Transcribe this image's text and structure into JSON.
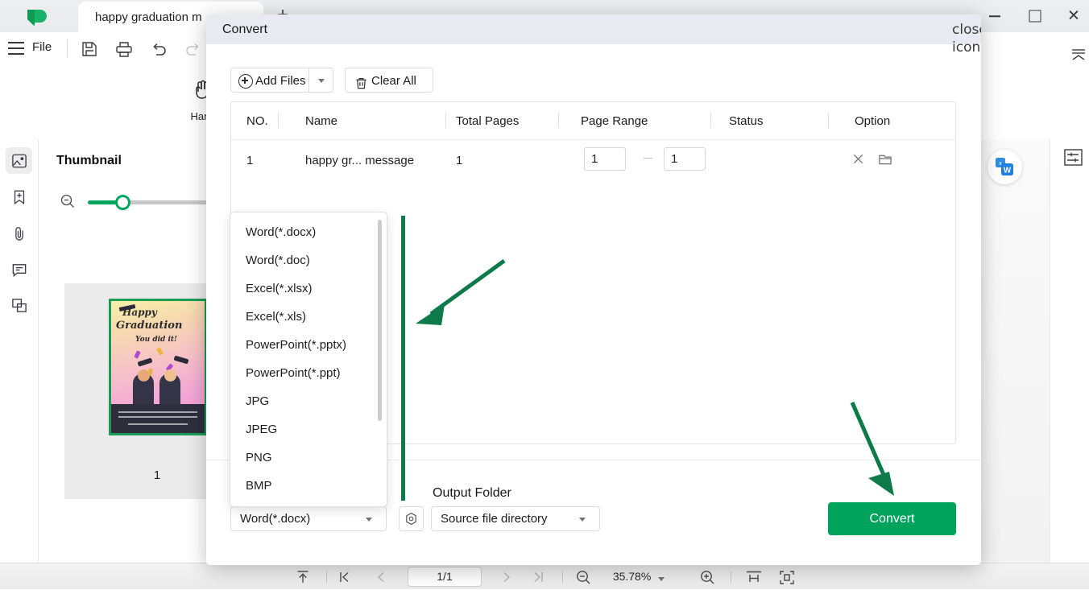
{
  "window": {
    "app_logo": "app-logo-icon",
    "tab_title": "happy graduation m",
    "new_tab": "+",
    "minimize": "minimize-icon",
    "maximize": "maximize-icon",
    "close": "close-icon"
  },
  "menubar": {
    "hamburger": "hamburger-icon",
    "file": "File",
    "icons": [
      "save-icon",
      "print-icon",
      "undo-icon",
      "redo-icon"
    ],
    "collapse_ribbon": "collapse-ribbon-icon"
  },
  "toolbar": {
    "hand_tool_label": "Hand",
    "hand_tool_icon": "hand-icon"
  },
  "left_rail": {
    "items": [
      {
        "name": "thumbnail-panel-icon",
        "active": true
      },
      {
        "name": "bookmark-add-icon",
        "active": false
      },
      {
        "name": "attachment-icon",
        "active": false
      },
      {
        "name": "comment-icon",
        "active": false
      },
      {
        "name": "layers-icon",
        "active": false
      }
    ]
  },
  "thumbnail_panel": {
    "title": "Thumbnail",
    "zoom_out_icon": "zoom-out-icon",
    "zoom_slider_value": 18,
    "page_number": "1",
    "poster": {
      "line1": "Happy",
      "line2": "Graduation",
      "line3": "You did it!"
    }
  },
  "right_rail": {
    "properties_icon": "properties-icon",
    "word_badge_icon": "word-convert-badge-icon"
  },
  "statusbar": {
    "fit_top_icon": "scroll-to-top-icon",
    "first_page_icon": "first-page-icon",
    "prev_page_icon": "previous-page-icon",
    "page_indicator": "1/1",
    "next_page_icon": "next-page-icon",
    "last_page_icon": "last-page-icon",
    "zoom_out_icon": "zoom-out-icon",
    "zoom_level": "35.78%",
    "zoom_in_icon": "zoom-in-icon",
    "fit_width_icon": "fit-width-icon",
    "fit_page_icon": "fit-page-icon"
  },
  "dialog": {
    "title": "Convert",
    "close_icon": "close-icon",
    "add_files_label": "Add Files",
    "add_files_icon": "plus-circle-icon",
    "add_files_caret": "chevron-down-icon",
    "clear_all_label": "Clear All",
    "clear_all_icon": "trash-icon",
    "table": {
      "headers": [
        "NO.",
        "Name",
        "Total Pages",
        "Page Range",
        "Status",
        "Option"
      ],
      "rows": [
        {
          "no": "1",
          "name": "happy gr... message",
          "total_pages": "1",
          "range_from": "1",
          "range_to": "1",
          "status": "",
          "remove_icon": "remove-file-icon",
          "folder_icon": "open-folder-icon"
        }
      ]
    },
    "output_folder_label": "Output Folder",
    "format_select": {
      "value": "Word(*.docx)",
      "caret": "chevron-down-icon"
    },
    "settings_icon": "settings-gear-icon",
    "output_select": {
      "value": "Source file directory",
      "caret": "chevron-down-icon"
    },
    "convert_label": "Convert",
    "format_dropdown": {
      "open": true,
      "options": [
        "Word(*.docx)",
        "Word(*.doc)",
        "Excel(*.xlsx)",
        "Excel(*.xls)",
        "PowerPoint(*.pptx)",
        "PowerPoint(*.ppt)",
        "JPG",
        "JPEG",
        "PNG",
        "BMP"
      ]
    }
  },
  "annotations": {
    "accent_color": "#0e7a4a",
    "arrow_to_dropdown": "annotation-arrow-to-format-dropdown",
    "arrow_to_convert": "annotation-arrow-to-convert-button",
    "vertical_line": "annotation-vertical-line"
  },
  "colors": {
    "brand_green": "#00a35c",
    "annotation_green": "#0e7a4a",
    "dialog_header": "#e7eaf1"
  }
}
